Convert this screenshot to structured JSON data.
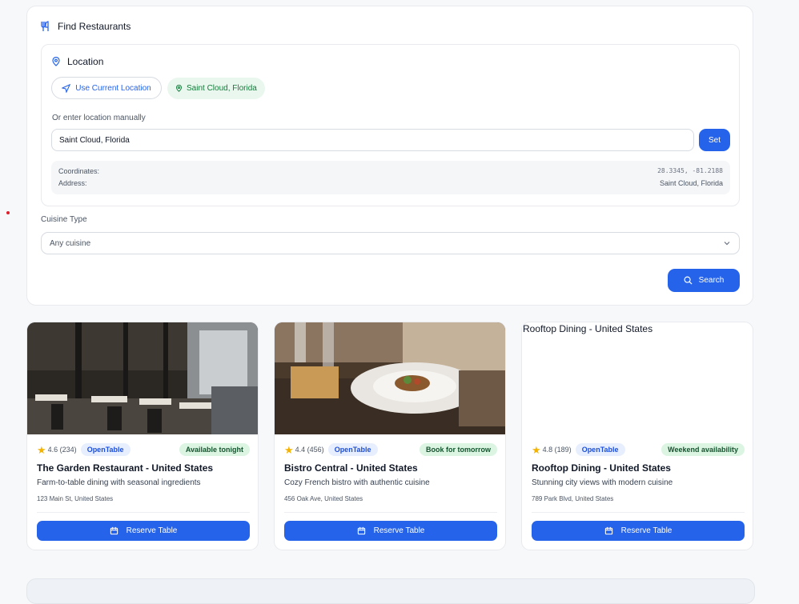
{
  "finder": {
    "title": "Find Restaurants",
    "location": {
      "title": "Location",
      "use_current_label": "Use Current Location",
      "current_chip": "Saint Cloud, Florida",
      "manual_label": "Or enter location manually",
      "manual_value": "Saint Cloud, Florida",
      "set_label": "Set",
      "coordinates_label": "Coordinates:",
      "coordinates_value": "28.3345, -81.2188",
      "address_label": "Address:",
      "address_value": "Saint Cloud, Florida"
    },
    "cuisine": {
      "label": "Cuisine Type",
      "selected": "Any cuisine"
    },
    "search_label": "Search"
  },
  "restaurants": [
    {
      "rating": "4.6 (234)",
      "platform": "OpenTable",
      "availability": "Available tonight",
      "name": "The Garden Restaurant - United States",
      "description": "Farm-to-table dining with seasonal ingredients",
      "address": "123 Main St, United States",
      "reserve_label": "Reserve Table",
      "image_alt": ""
    },
    {
      "rating": "4.4 (456)",
      "platform": "OpenTable",
      "availability": "Book for tomorrow",
      "name": "Bistro Central - United States",
      "description": "Cozy French bistro with authentic cuisine",
      "address": "456 Oak Ave, United States",
      "reserve_label": "Reserve Table",
      "image_alt": ""
    },
    {
      "rating": "4.8 (189)",
      "platform": "OpenTable",
      "availability": "Weekend availability",
      "name": "Rooftop Dining - United States",
      "description": "Stunning city views with modern cuisine",
      "address": "789 Park Blvd, United States",
      "reserve_label": "Reserve Table",
      "image_alt": "Rooftop Dining - United States"
    }
  ],
  "colors": {
    "accent": "#2563eb",
    "available_green": "#dcf5e3",
    "star": "#f5b301"
  }
}
